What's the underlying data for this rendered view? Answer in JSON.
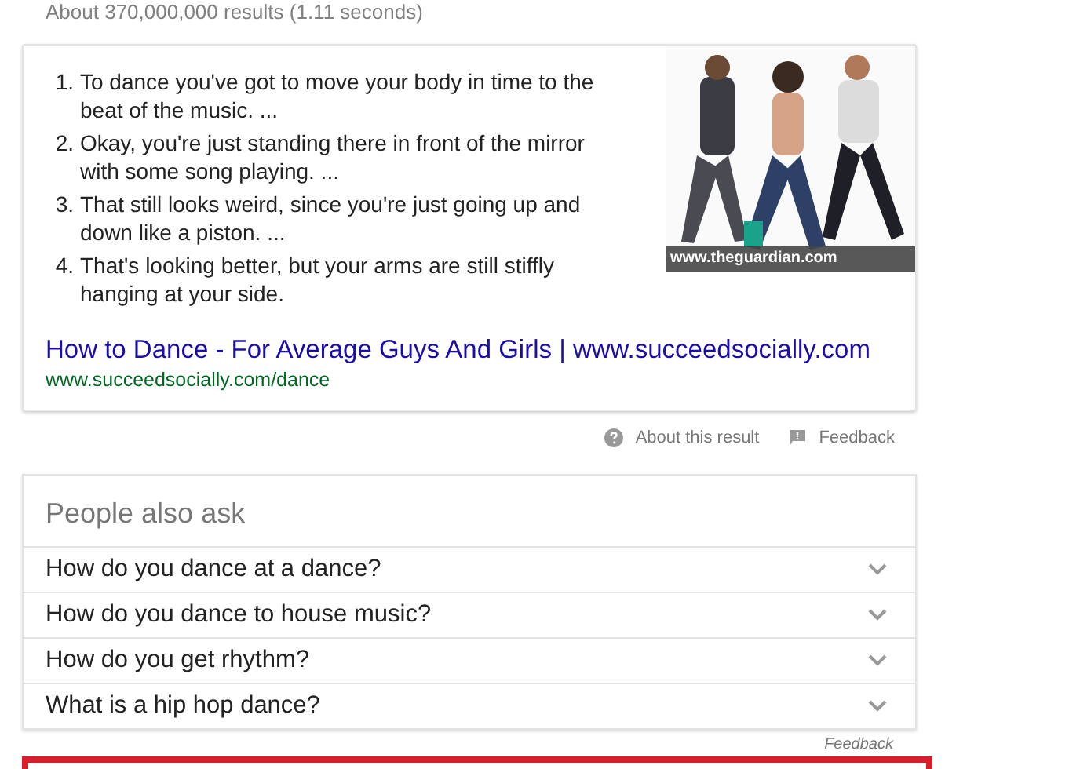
{
  "result_stats": "About 370,000,000 results (1.11 seconds)",
  "snippet": {
    "steps": [
      {
        "number": "1.",
        "text": "To dance you've got to move your body in time to the beat of the music. ..."
      },
      {
        "number": "2.",
        "text": "Okay, you're just standing there in front of the mirror with some song playing. ..."
      },
      {
        "number": "3.",
        "text": "That still looks weird, since you're just going up and down like a piston. ..."
      },
      {
        "number": "4.",
        "text": "That's looking better, but your arms are still stiffly hanging at your side."
      }
    ],
    "image": {
      "kind": "picture",
      "caption": "www.theguardian.com"
    },
    "link_title": "How to Dance - For Average Guys And Girls | www.succeedsocially.com",
    "url": "www.succeedsocially.com/dance"
  },
  "snippet_footer": {
    "about": "About this result",
    "feedback": "Feedback"
  },
  "people_also_ask": {
    "title": "People also ask",
    "questions": [
      {
        "text": "How do you dance at a dance?",
        "expanded": false
      },
      {
        "text": "How do you dance to house music?",
        "expanded": false
      },
      {
        "text": "How do you get rhythm?",
        "expanded": false
      },
      {
        "text": "What is a hip hop dance?",
        "expanded": false
      }
    ],
    "feedback": "Feedback"
  }
}
